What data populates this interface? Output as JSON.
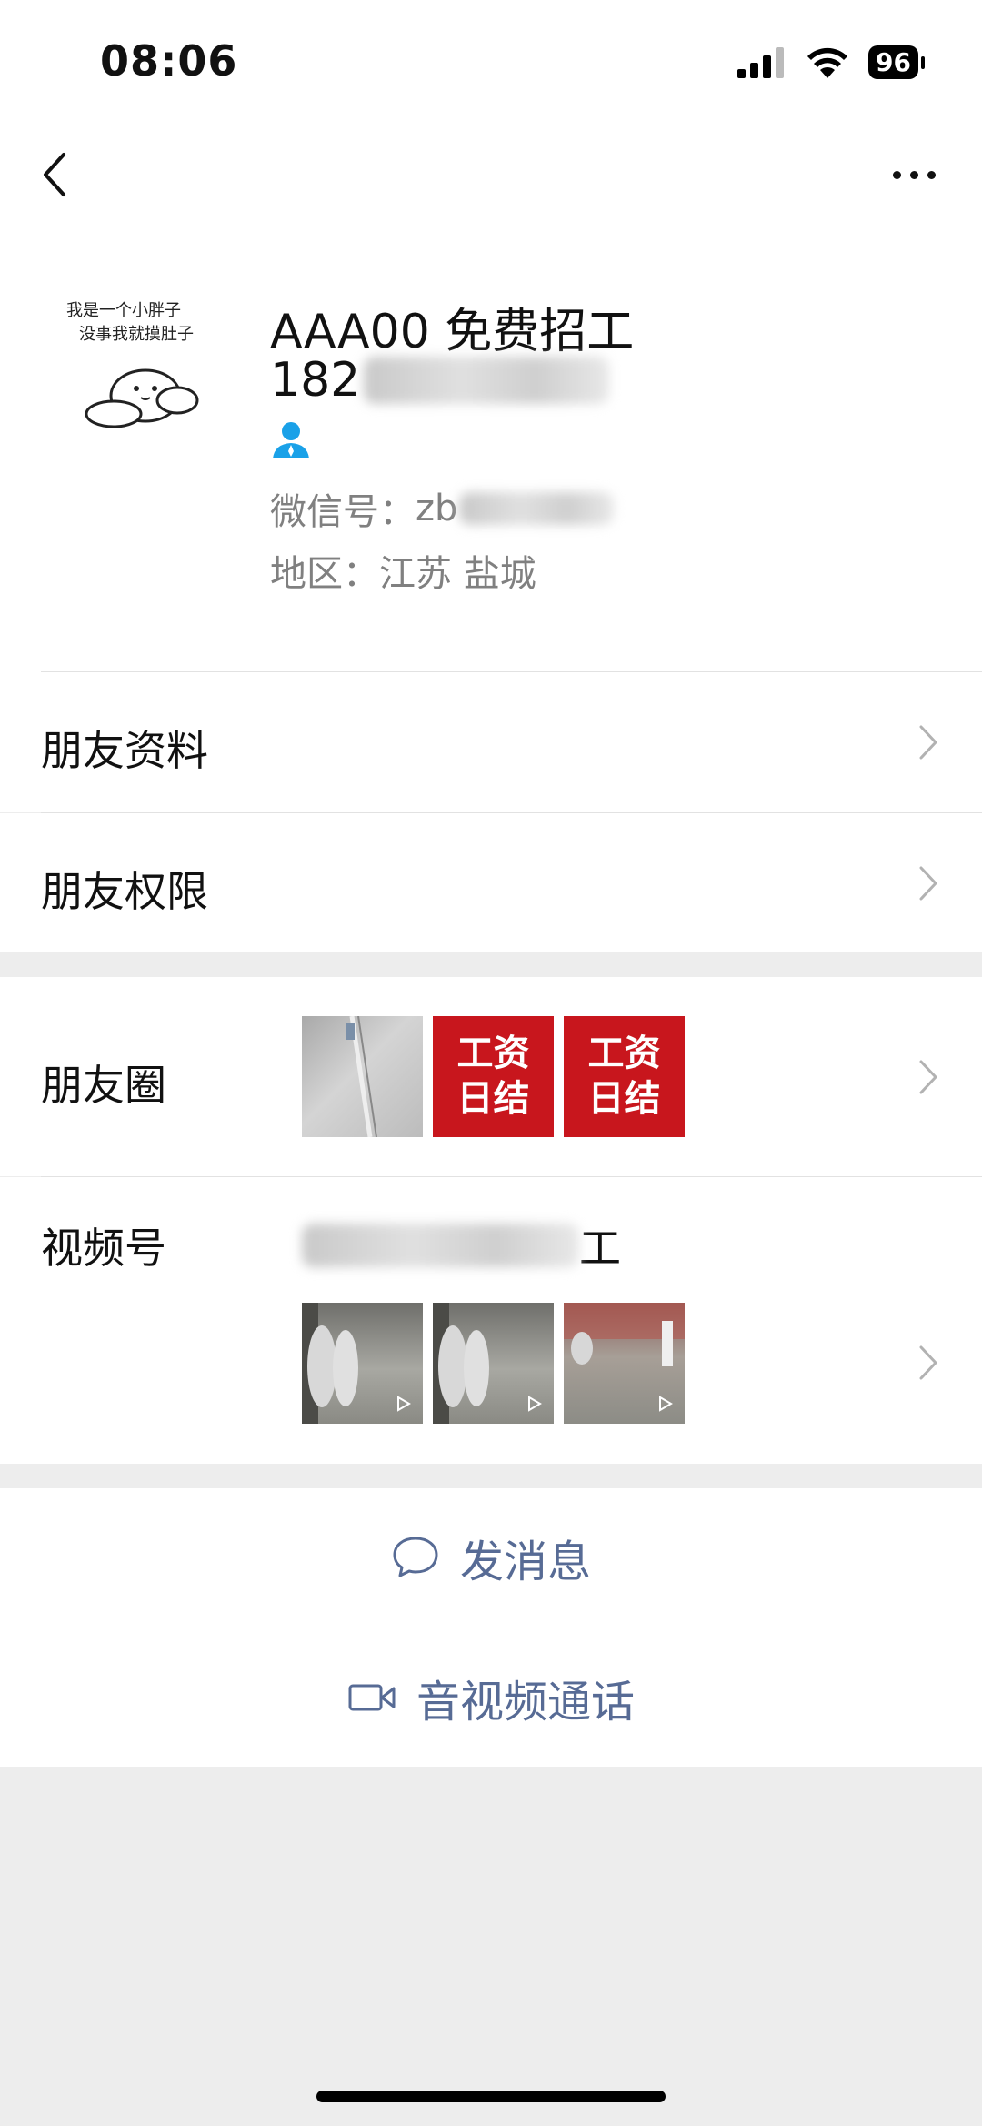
{
  "status_bar": {
    "time": "08:06",
    "battery": "96"
  },
  "profile": {
    "nickname": "AAA00 免费招工",
    "phone_visible": "182",
    "wechat_id_label": "微信号：",
    "wechat_id_visible": "zb",
    "region": "地区：江苏 盐城",
    "avatar_text_line1": "我是一个小胖子",
    "avatar_text_line2": "没事我就摸肚子"
  },
  "menu": {
    "friend_profile": "朋友资料",
    "friend_permissions": "朋友权限",
    "moments": "朋友圈",
    "channels": "视频号",
    "channels_name_visible": "工"
  },
  "moments_thumbs": [
    {
      "type": "photo"
    },
    {
      "type": "text",
      "line1": "工资",
      "line2": "日结"
    },
    {
      "type": "text",
      "line1": "工资",
      "line2": "日结"
    }
  ],
  "actions": {
    "message": "发消息",
    "call": "音视频通话"
  },
  "colors": {
    "link": "#576b95",
    "red_tile": "#c8161d",
    "background": "#ededed"
  }
}
